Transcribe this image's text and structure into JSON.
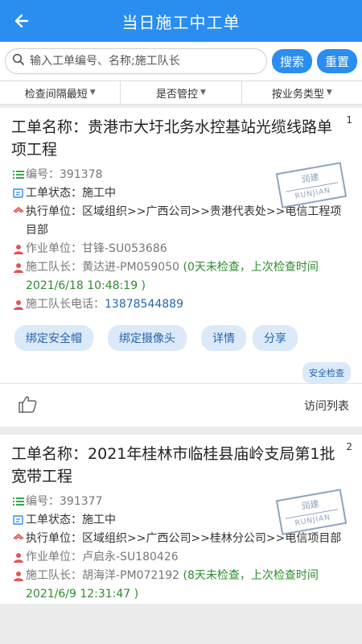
{
  "header": {
    "title": "当日施工中工单"
  },
  "search": {
    "placeholder": "输入工单编号、名称;施工队长",
    "search_label": "搜索",
    "reset_label": "重置"
  },
  "filters": [
    "检查间隔最短",
    "是否管控",
    "按业务类型"
  ],
  "labels": {
    "name": "工单名称：",
    "number": "编号：",
    "status": "工单状态：",
    "exec": "执行单位：",
    "work": "作业单位：",
    "leader": "施工队长：",
    "phone": "施工队长电话："
  },
  "stamp": {
    "cn": "润建",
    "en": "RUNJIAN"
  },
  "actions": {
    "bind_helmet": "绑定安全帽",
    "bind_camera": "绑定摄像头",
    "detail": "详情",
    "share": "分享",
    "safety_check": "安全检查",
    "visit_list": "访问列表"
  },
  "cards": [
    {
      "index": "1",
      "name": "贵港市大圩北务水控基站光缆线路单项工程",
      "number": "391378",
      "status": "施工中",
      "exec_unit": "区域组织>>广西公司>>贵港代表处>>电信工程项目部",
      "work_unit": "甘锋-SU053686",
      "leader": "黄达进-PM059050",
      "leader_note": "(0天未检查，上次检查时间2021/6/18 10:48:19 )",
      "phone": "13878544889"
    },
    {
      "index": "2",
      "name": "2021年桂林市临桂县庙岭支局第1批宽带工程",
      "number": "391377",
      "status": "施工中",
      "exec_unit": "区域组织>>广西公司>>桂林分公司>>电信项目部",
      "work_unit": "卢启永-SU180426",
      "leader": "胡海洋-PM072192",
      "leader_note": "(8天未检查，上次检查时间2021/6/9 12:31:47 )"
    }
  ],
  "colors": {
    "primary": "#2a8df0",
    "pill_bg": "#dbe9f8",
    "pill_text": "#2566b0",
    "green": "#2e8b2e",
    "icon_red": "#e05656"
  }
}
